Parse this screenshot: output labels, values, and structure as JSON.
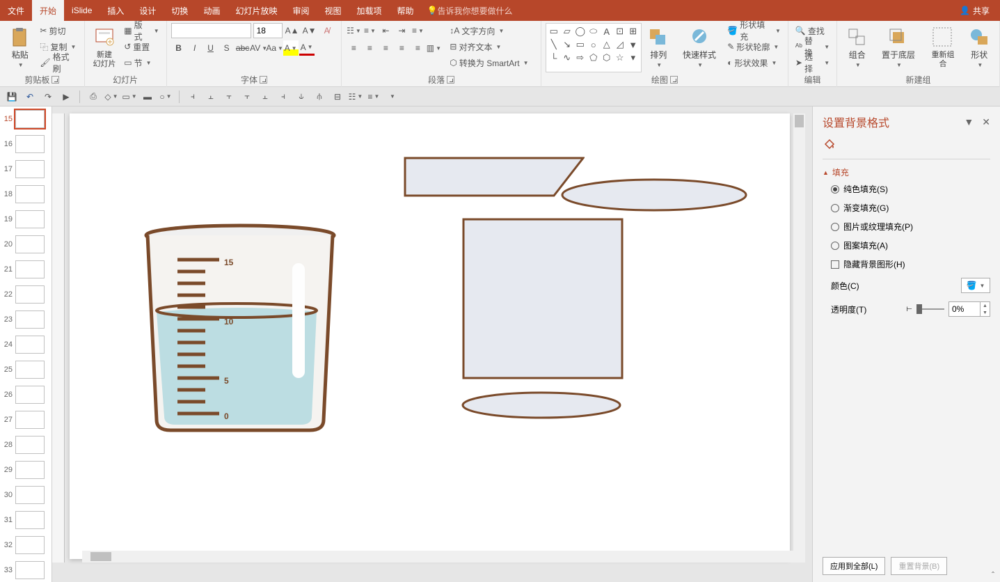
{
  "menu": {
    "file": "文件",
    "home": "开始",
    "islide": "iSlide",
    "insert": "插入",
    "design": "设计",
    "transitions": "切换",
    "animations": "动画",
    "slideshow": "幻灯片放映",
    "review": "审阅",
    "view": "视图",
    "addins": "加载项",
    "help": "帮助",
    "tellme": "告诉我你想要做什么",
    "share": "共享"
  },
  "ribbon": {
    "clipboard": {
      "label": "剪贴板",
      "paste": "粘贴",
      "cut": "剪切",
      "copy": "复制",
      "painter": "格式刷"
    },
    "slides": {
      "label": "幻灯片",
      "new": "新建\n幻灯片",
      "layout": "版式",
      "reset": "重置",
      "section": "节"
    },
    "font": {
      "label": "字体",
      "size": "18"
    },
    "paragraph": {
      "label": "段落",
      "textdir": "文字方向",
      "align": "对齐文本",
      "smartart": "转换为 SmartArt"
    },
    "drawing": {
      "label": "绘图",
      "arrange": "排列",
      "quickstyle": "快速样式",
      "fill": "形状填充",
      "outline": "形状轮廓",
      "effects": "形状效果"
    },
    "editing": {
      "label": "编辑",
      "find": "查找",
      "replace": "替换",
      "select": "选择"
    },
    "newgroup": {
      "label": "新建组",
      "group": "组合",
      "back": "置于底层",
      "regroup": "重新组合",
      "shape": "形状"
    }
  },
  "thumbs": {
    "numbers": [
      "15",
      "16",
      "17",
      "18",
      "19",
      "20",
      "21",
      "22",
      "23",
      "24",
      "25",
      "26",
      "27",
      "28",
      "29",
      "30",
      "31",
      "32",
      "33"
    ]
  },
  "panel": {
    "title": "设置背景格式",
    "fill": "填充",
    "solid": "纯色填充(S)",
    "gradient": "渐变填充(G)",
    "picture": "图片或纹理填充(P)",
    "pattern": "图案填充(A)",
    "hidebg": "隐藏背景图形(H)",
    "color": "颜色(C)",
    "transparency": "透明度(T)",
    "trans_val": "0%",
    "apply_all": "应用到全部(L)",
    "reset": "重置背景(B)"
  },
  "slide_content": {
    "beaker_marks": [
      "15",
      "10",
      "5",
      "0"
    ]
  }
}
